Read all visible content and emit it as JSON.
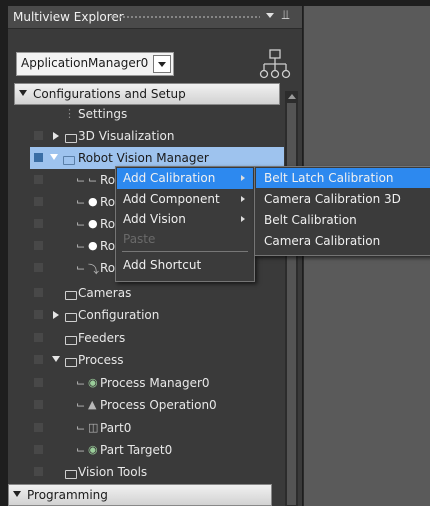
{
  "panel": {
    "title": "Multiview Explorer",
    "pin_icon": "pin-icon"
  },
  "selector": {
    "value": "ApplicationManager0"
  },
  "sections": {
    "config": "Configurations and Setup",
    "programming": "Programming"
  },
  "tree": [
    {
      "label": "Settings",
      "icon": "settings-icon"
    },
    {
      "label": "3D Visualization",
      "icon": "folder-icon",
      "expander": "collapsed"
    },
    {
      "label": "Robot Vision Manager",
      "icon": "folder-icon",
      "expander": "expanded",
      "selected": true
    },
    {
      "label": "Ro",
      "icon": "calibration-icon"
    },
    {
      "label": "Ro",
      "icon": "vision-icon"
    },
    {
      "label": "Ro",
      "icon": "vision-icon"
    },
    {
      "label": "Ro",
      "icon": "vision-icon"
    },
    {
      "label": "Ro",
      "icon": "location-icon"
    },
    {
      "label": "Cameras",
      "icon": "folder-icon"
    },
    {
      "label": "Configuration",
      "icon": "folder-icon",
      "expander": "collapsed"
    },
    {
      "label": "Feeders",
      "icon": "folder-icon"
    },
    {
      "label": "Process",
      "icon": "folder-icon",
      "expander": "expanded"
    },
    {
      "label": "Process Manager0",
      "icon": "process-manager-icon"
    },
    {
      "label": "Process Operation0",
      "icon": "process-operation-icon"
    },
    {
      "label": "Part0",
      "icon": "part-icon"
    },
    {
      "label": "Part Target0",
      "icon": "part-target-icon"
    },
    {
      "label": "Vision Tools",
      "icon": "folder-icon"
    }
  ],
  "context_menu": [
    {
      "label": "Add Calibration",
      "submenu": true,
      "active": true
    },
    {
      "label": "Add Component",
      "submenu": true
    },
    {
      "label": "Add Vision",
      "submenu": true
    },
    {
      "label": "Paste",
      "disabled": true
    },
    {
      "label": "Add Shortcut"
    }
  ],
  "submenu": [
    {
      "label": "Belt Latch Calibration",
      "active": true
    },
    {
      "label": "Camera Calibration 3D"
    },
    {
      "label": "Belt Calibration"
    },
    {
      "label": "Camera Calibration"
    }
  ],
  "colors": {
    "selection": "#9ec3ee",
    "menu_highlight": "#2d89ef",
    "panel_bg": "#3a3a3a"
  }
}
